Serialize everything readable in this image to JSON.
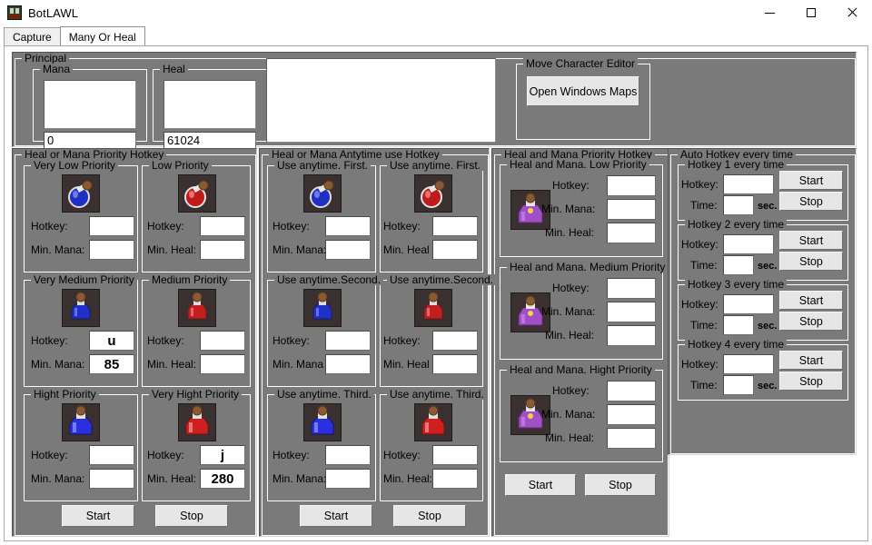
{
  "window": {
    "title": "BotLAWL",
    "icon": "app-icon",
    "controls": {
      "minimize": "minimize-icon",
      "maximize": "maximize-icon",
      "close": "close-icon"
    }
  },
  "tabs": [
    {
      "label": "Capture",
      "active": false
    },
    {
      "label": "Many Or Heal",
      "active": true
    }
  ],
  "principal": {
    "title": "Principal",
    "mana": {
      "title": "Mana",
      "value": "0"
    },
    "heal": {
      "title": "Heal",
      "value": "61024"
    },
    "preview": ""
  },
  "move_character_editor": {
    "title": "Move Character Editor",
    "open_maps_button": "Open Windows Maps"
  },
  "heal_or_mana_priority": {
    "title": "Heal or Mana Priority Hotkey",
    "groups": [
      {
        "title": "Very Low Priority",
        "potion": "blue-potion-round",
        "fields": [
          {
            "label": "Hotkey:",
            "value": ""
          },
          {
            "label": "Min. Mana:",
            "value": ""
          }
        ]
      },
      {
        "title": "Low Priority",
        "potion": "red-potion-round",
        "fields": [
          {
            "label": "Hotkey:",
            "value": ""
          },
          {
            "label": "Min. Heal:",
            "value": ""
          }
        ]
      },
      {
        "title": "Very Medium Priority",
        "potion": "blue-potion-flask",
        "fields": [
          {
            "label": "Hotkey:",
            "value": "u"
          },
          {
            "label": "Min. Mana:",
            "value": "85"
          }
        ]
      },
      {
        "title": "Medium Priority",
        "potion": "red-potion-flask",
        "fields": [
          {
            "label": "Hotkey:",
            "value": ""
          },
          {
            "label": "Min. Heal:",
            "value": ""
          }
        ]
      },
      {
        "title": "Hight Priority",
        "potion": "blue-potion-large",
        "fields": [
          {
            "label": "Hotkey:",
            "value": ""
          },
          {
            "label": "Min. Mana:",
            "value": ""
          }
        ]
      },
      {
        "title": "Very Hight Priority",
        "potion": "red-potion-large",
        "fields": [
          {
            "label": "Hotkey:",
            "value": "j"
          },
          {
            "label": "Min. Heal:",
            "value": "280"
          }
        ]
      }
    ],
    "start_button": "Start",
    "stop_button": "Stop"
  },
  "heal_or_mana_anytime": {
    "title": "Heal or Mana Antytime use Hotkey",
    "groups": [
      {
        "title": "Use anytime. First.",
        "potion": "blue-potion-round",
        "fields": [
          {
            "label": "Hotkey:",
            "value": ""
          },
          {
            "label": "Min. Mana:",
            "value": ""
          }
        ]
      },
      {
        "title": "Use anytime. First.",
        "potion": "red-potion-round",
        "fields": [
          {
            "label": "Hotkey:",
            "value": ""
          },
          {
            "label": "Min. Heal",
            "value": ""
          }
        ]
      },
      {
        "title": "Use anytime.Second.",
        "potion": "blue-potion-flask",
        "fields": [
          {
            "label": "Hotkey:",
            "value": ""
          },
          {
            "label": "Min. Mana",
            "value": ""
          }
        ]
      },
      {
        "title": "Use anytime.Second.",
        "potion": "red-potion-flask",
        "fields": [
          {
            "label": "Hotkey:",
            "value": ""
          },
          {
            "label": "Min. Heal",
            "value": ""
          }
        ]
      },
      {
        "title": "Use anytime. Third.",
        "potion": "blue-potion-large",
        "fields": [
          {
            "label": "Hotkey:",
            "value": ""
          },
          {
            "label": "Min. Mana:",
            "value": ""
          }
        ]
      },
      {
        "title": "Use anytime. Third.",
        "potion": "red-potion-large",
        "fields": [
          {
            "label": "Hotkey:",
            "value": ""
          },
          {
            "label": "Min. Heal:",
            "value": ""
          }
        ]
      }
    ],
    "start_button": "Start",
    "stop_button": "Stop"
  },
  "heal_and_mana_priority": {
    "title": "Heal and Mana Priority Hotkey",
    "groups": [
      {
        "title": "Heal and Mana. Low Priority",
        "potion": "purple-potion",
        "fields": [
          {
            "label": "Hotkey:",
            "value": ""
          },
          {
            "label": "Min. Mana:",
            "value": ""
          },
          {
            "label": "Min. Heal:",
            "value": ""
          }
        ]
      },
      {
        "title": "Heal and Mana. Medium Priority",
        "potion": "purple-potion",
        "fields": [
          {
            "label": "Hotkey:",
            "value": ""
          },
          {
            "label": "Min. Mana:",
            "value": ""
          },
          {
            "label": "Min. Heal:",
            "value": ""
          }
        ]
      },
      {
        "title": "Heal and Mana. Hight Priority",
        "potion": "purple-potion",
        "fields": [
          {
            "label": "Hotkey:",
            "value": ""
          },
          {
            "label": "Min. Mana:",
            "value": ""
          },
          {
            "label": "Min. Heal:",
            "value": ""
          }
        ]
      }
    ],
    "start_button": "Start",
    "stop_button": "Stop"
  },
  "auto_hotkey": {
    "title": "Auto Hotkey every time",
    "groups": [
      {
        "title": "Hotkey 1 every time",
        "hotkey_label": "Hotkey:",
        "hotkey_value": "",
        "time_label": "Time:",
        "time_value": "",
        "sec_label": "sec.",
        "start_button": "Start",
        "stop_button": "Stop"
      },
      {
        "title": "Hotkey 2 every time",
        "hotkey_label": "Hotkey:",
        "hotkey_value": "",
        "time_label": "Time:",
        "time_value": "",
        "sec_label": "sec.",
        "start_button": "Start",
        "stop_button": "Stop"
      },
      {
        "title": "Hotkey 3 every time",
        "hotkey_label": "Hotkey:",
        "hotkey_value": "",
        "time_label": "Time:",
        "time_value": "",
        "sec_label": "sec.",
        "start_button": "Start",
        "stop_button": "Stop"
      },
      {
        "title": "Hotkey 4 every time",
        "hotkey_label": "Hotkey:",
        "hotkey_value": "",
        "time_label": "Time:",
        "time_value": "",
        "sec_label": "sec.",
        "start_button": "Start",
        "stop_button": "Stop"
      }
    ]
  },
  "colors": {
    "panel_bg": "#7a7a7a",
    "window_bg": "#ffffff",
    "button_face": "#e6e6e6",
    "field_bg": "#ffffff",
    "mana_blue": "#2a3ad0",
    "heal_red": "#c42020",
    "combo_purple": "#9b4fc0"
  }
}
